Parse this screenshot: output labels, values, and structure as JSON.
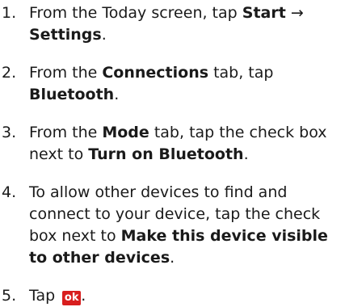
{
  "steps": [
    {
      "number": "1.",
      "parts": {
        "a": "From the Today screen, tap ",
        "b": "Start",
        "c": " → ",
        "d": "Settings",
        "e": "."
      }
    },
    {
      "number": "2.",
      "parts": {
        "a": "From the ",
        "b": "Connections",
        "c": " tab, tap ",
        "d": "Bluetooth",
        "e": "."
      }
    },
    {
      "number": "3.",
      "parts": {
        "a": "From the ",
        "b": "Mode",
        "c": " tab, tap the check box next to ",
        "d": "Turn on Bluetooth",
        "e": "."
      }
    },
    {
      "number": "4.",
      "parts": {
        "a": "To allow other devices to find and connect to your device, tap the check box next to ",
        "b": "Make this device visible to other devices",
        "c": "."
      }
    },
    {
      "number": "5.",
      "parts": {
        "a": "Tap ",
        "icon_label": "ok",
        "b": "."
      }
    }
  ],
  "colors": {
    "ok_icon_bg": "#d81e1e",
    "ok_icon_fg": "#ffffff"
  },
  "icons": {
    "ok_button": "ok-button-icon"
  }
}
